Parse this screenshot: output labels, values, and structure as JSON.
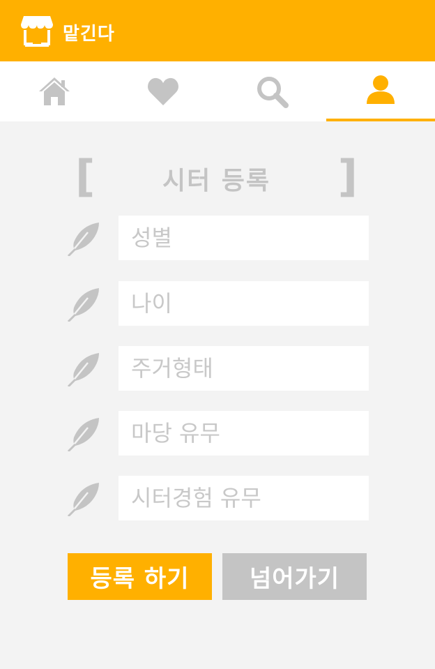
{
  "app": {
    "title": "맡긴다"
  },
  "nav": {
    "tabs": [
      {
        "icon": "home-icon",
        "active": false
      },
      {
        "icon": "heart-icon",
        "active": false
      },
      {
        "icon": "search-icon",
        "active": false
      },
      {
        "icon": "user-icon",
        "active": true
      }
    ]
  },
  "form": {
    "title": "시터 등록",
    "bracket_left": "[",
    "bracket_right": "]",
    "fields": [
      {
        "placeholder": "성별",
        "value": "",
        "icon": "feather-icon"
      },
      {
        "placeholder": "나이",
        "value": "",
        "icon": "feather-icon"
      },
      {
        "placeholder": "주거형태",
        "value": "",
        "icon": "feather-icon"
      },
      {
        "placeholder": "마당 유무",
        "value": "",
        "icon": "feather-icon"
      },
      {
        "placeholder": "시터경험 유무",
        "value": "",
        "icon": "feather-icon"
      }
    ]
  },
  "buttons": {
    "register": "등록 하기",
    "skip": "넘어가기"
  },
  "colors": {
    "accent": "#ffb000",
    "muted": "#c4c4c4",
    "background": "#f3f3f3",
    "white": "#ffffff"
  }
}
